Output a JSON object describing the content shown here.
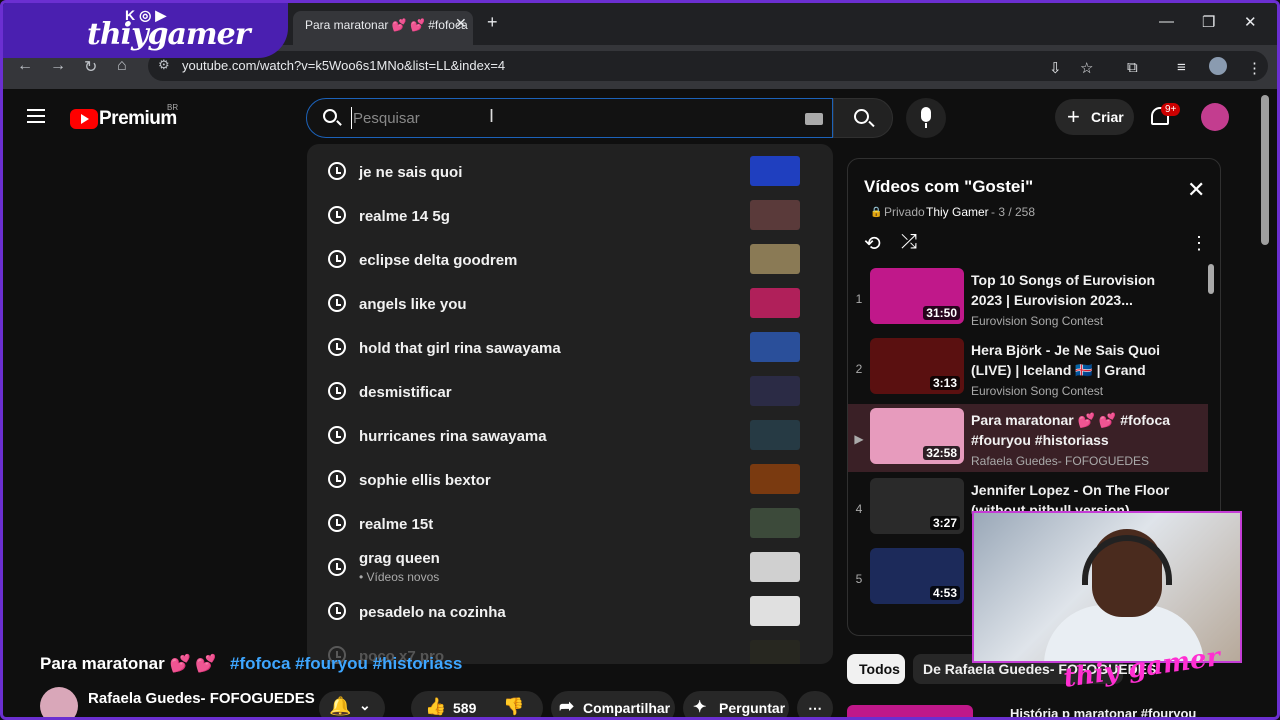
{
  "browser": {
    "tab_title": "Para maratonar 💕 💕 #fofoca",
    "url": "youtube.com/watch?v=k5Woo6s1MNo&list=LL&index=4"
  },
  "overlay": {
    "streamer_name": "thiygamer",
    "streamer_icons": "K◎▶"
  },
  "header": {
    "brand": "Premium",
    "region": "BR",
    "search_placeholder": "Pesquisar",
    "create_label": "Criar",
    "notification_count": "9+"
  },
  "suggestions": [
    {
      "text": "je ne sais quoi",
      "thumb_color": "#1f3fbf"
    },
    {
      "text": "realme 14 5g",
      "thumb_color": "#5a3a3a"
    },
    {
      "text": "eclipse delta goodrem",
      "thumb_color": "#8a7a55"
    },
    {
      "text": "angels like you",
      "thumb_color": "#b0205a"
    },
    {
      "text": "hold that girl rina sawayama",
      "thumb_color": "#2a4f9a"
    },
    {
      "text": "desmistificar",
      "thumb_color": "#2b2b45"
    },
    {
      "text": "hurricanes rina sawayama",
      "thumb_color": "#263a44"
    },
    {
      "text": "sophie ellis bextor",
      "thumb_color": "#7a3a10"
    },
    {
      "text": "realme 15t",
      "thumb_color": "#3c4a3a"
    },
    {
      "text": "grag queen",
      "sub": "• Vídeos novos",
      "thumb_color": "#d0d0d0"
    },
    {
      "text": "pesadelo na cozinha",
      "thumb_color": "#e0e0e0"
    },
    {
      "text": "poco x7 pro",
      "thumb_color": "#3a3a20"
    }
  ],
  "playlist": {
    "title": "Vídeos com \"Gostei\"",
    "privacy": "Privado",
    "owner": "Thiy Gamer",
    "count": "- 3 / 258",
    "items": [
      {
        "index": "1",
        "title": "Top 10 Songs of Eurovision 2023 | Eurovision 2023...",
        "channel": "Eurovision Song Contest",
        "duration": "31:50",
        "thumb_color": "#c0188a"
      },
      {
        "index": "2",
        "title": "Hera Björk - Je Ne Sais Quoi (LIVE) | Iceland 🇮🇸 | Grand Fina...",
        "channel": "Eurovision Song Contest",
        "duration": "3:13",
        "thumb_color": "#5a1010"
      },
      {
        "index": "▶",
        "title": "Para maratonar 💕 💕 #fofoca #fouryou #historiass",
        "channel": "Rafaela Guedes- FOFOGUEDES",
        "duration": "32:58",
        "thumb_color": "#e79bbd"
      },
      {
        "index": "4",
        "title": "Jennifer Lopez - On The Floor (without pitbull version)",
        "channel": "",
        "duration": "3:27",
        "thumb_color": "#2a2a2a"
      },
      {
        "index": "5",
        "title": "",
        "channel": "",
        "duration": "4:53",
        "thumb_color": "#1c2a5a"
      }
    ]
  },
  "video": {
    "title": "Para maratonar 💕 💕",
    "tags": "#fofoca #fouryou #historiass",
    "channel": "Rafaela Guedes- FOFOGUEDES",
    "likes": "589",
    "share_label": "Compartilhar",
    "ask_label": "Perguntar"
  },
  "chips": {
    "all": "Todos",
    "from_channel": "De Rafaela Guedes- FOFOGUEDES"
  },
  "bottom_next_title": "História p maratonar #fouryou"
}
